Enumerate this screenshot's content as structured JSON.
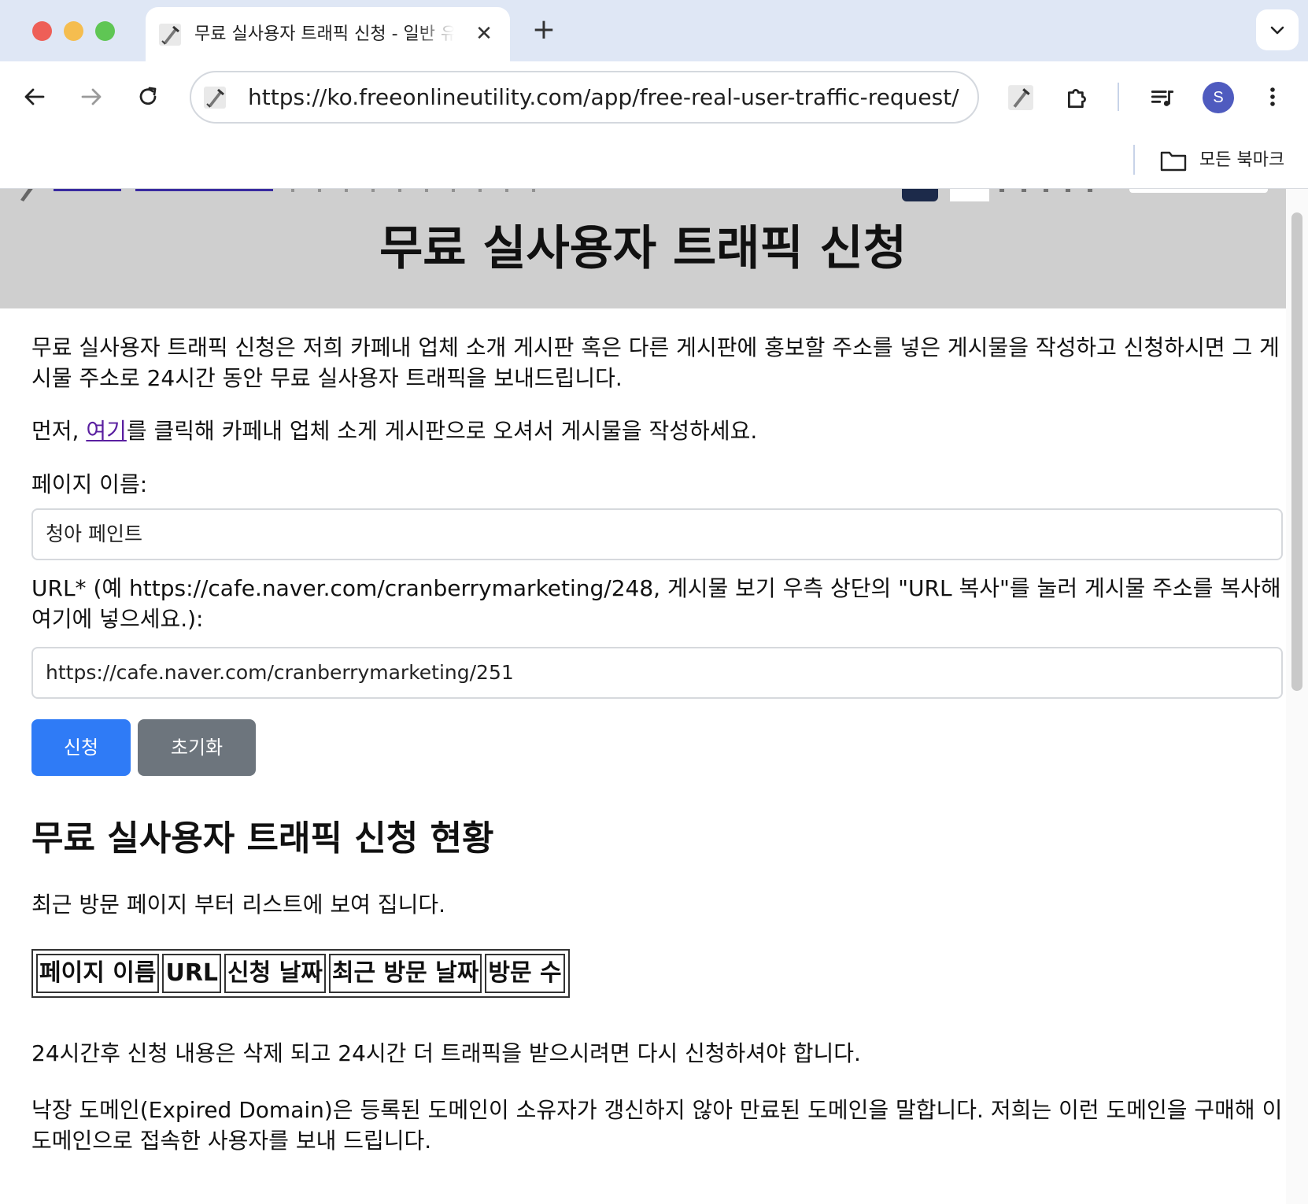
{
  "browser": {
    "tab": {
      "title": "무료 실사용자 트래픽 신청 - 일반 유틸리티",
      "close_icon": "✕"
    },
    "new_tab_icon": "+",
    "address_bar": {
      "url": "https://ko.freeonlineutility.com/app/free-real-user-traffic-request/"
    },
    "profile_initial": "S",
    "bookmarks": {
      "all_bookmarks_label": "모든 북마크"
    }
  },
  "page": {
    "title": "무료 실사용자 트래픽 신청",
    "intro": "무료 실사용자 트래픽 신청은 저희 카페내 업체 소개 게시판 혹은 다른 게시판에 홍보할 주소를 넣은 게시물을 작성하고 신청하시면 그 게시물 주소로 24시간 동안 무료 실사용자 트래픽을 보내드립니다.",
    "instruction": {
      "prefix": "먼저, ",
      "link_text": "여기",
      "suffix": "를 클릭해 카페내 업체 소게 게시판으로 오셔서 게시물을 작성하세요."
    },
    "form": {
      "page_name_label": "페이지 이름:",
      "page_name_value": "청아 페인트",
      "url_label": "URL* (예 https://cafe.naver.com/cranberrymarketing/248, 게시물 보기 우측 상단의 \"URL 복사\"를 눌러 게시물 주소를 복사해 여기에 넣으세요.):",
      "url_value": "https://cafe.naver.com/cranberrymarketing/251",
      "submit_label": "신청",
      "reset_label": "초기화"
    },
    "status": {
      "title": "무료 실사용자 트래픽 신청 현황",
      "description": "최근 방문 페이지 부터 리스트에 보여 집니다.",
      "columns": [
        "페이지 이름",
        "URL",
        "신청 날짜",
        "최근 방문 날짜",
        "방문 수"
      ]
    },
    "notice": "24시간후 신청 내용은 삭제 되고 24시간 더 트래픽을 받으시려면 다시 신청하셔야 합니다.",
    "expired_domain_note": "낙장 도메인(Expired Domain)은 등록된 도메인이 소유자가 갱신하지 않아 만료된 도메인을 말합니다. 저희는 이런 도메인을 구매해 이 도메인으로 접속한 사용자를 보내 드립니다."
  },
  "colors": {
    "tabstrip_bg": "#dfe7f5",
    "header_band": "#cfcfcf",
    "submit_button": "#2f7bf6",
    "reset_button": "#6d757d",
    "link": "#5a1fa0",
    "avatar": "#4f5bbf"
  }
}
